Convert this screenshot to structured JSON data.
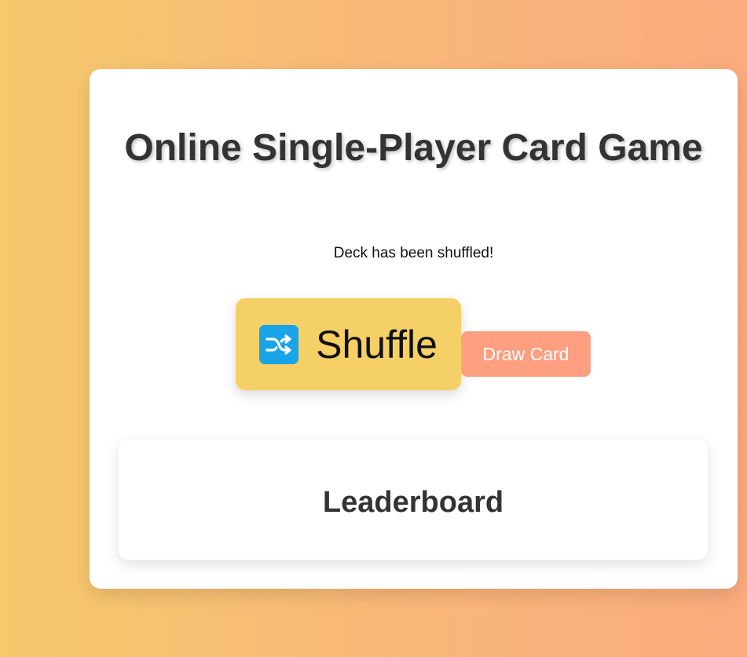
{
  "header": {
    "title": "Online Single-Player Card Game"
  },
  "status": {
    "message": "Deck has been shuffled!"
  },
  "controls": {
    "shuffle_icon": "shuffle-icon",
    "shuffle_label": "Shuffle",
    "draw_label": "Draw Card"
  },
  "leaderboard": {
    "title": "Leaderboard"
  },
  "colors": {
    "shuffle_button": "#f5d066",
    "shuffle_icon_bg": "#1aa4e8",
    "draw_button": "#fd9f80",
    "text_dark": "#333333"
  }
}
